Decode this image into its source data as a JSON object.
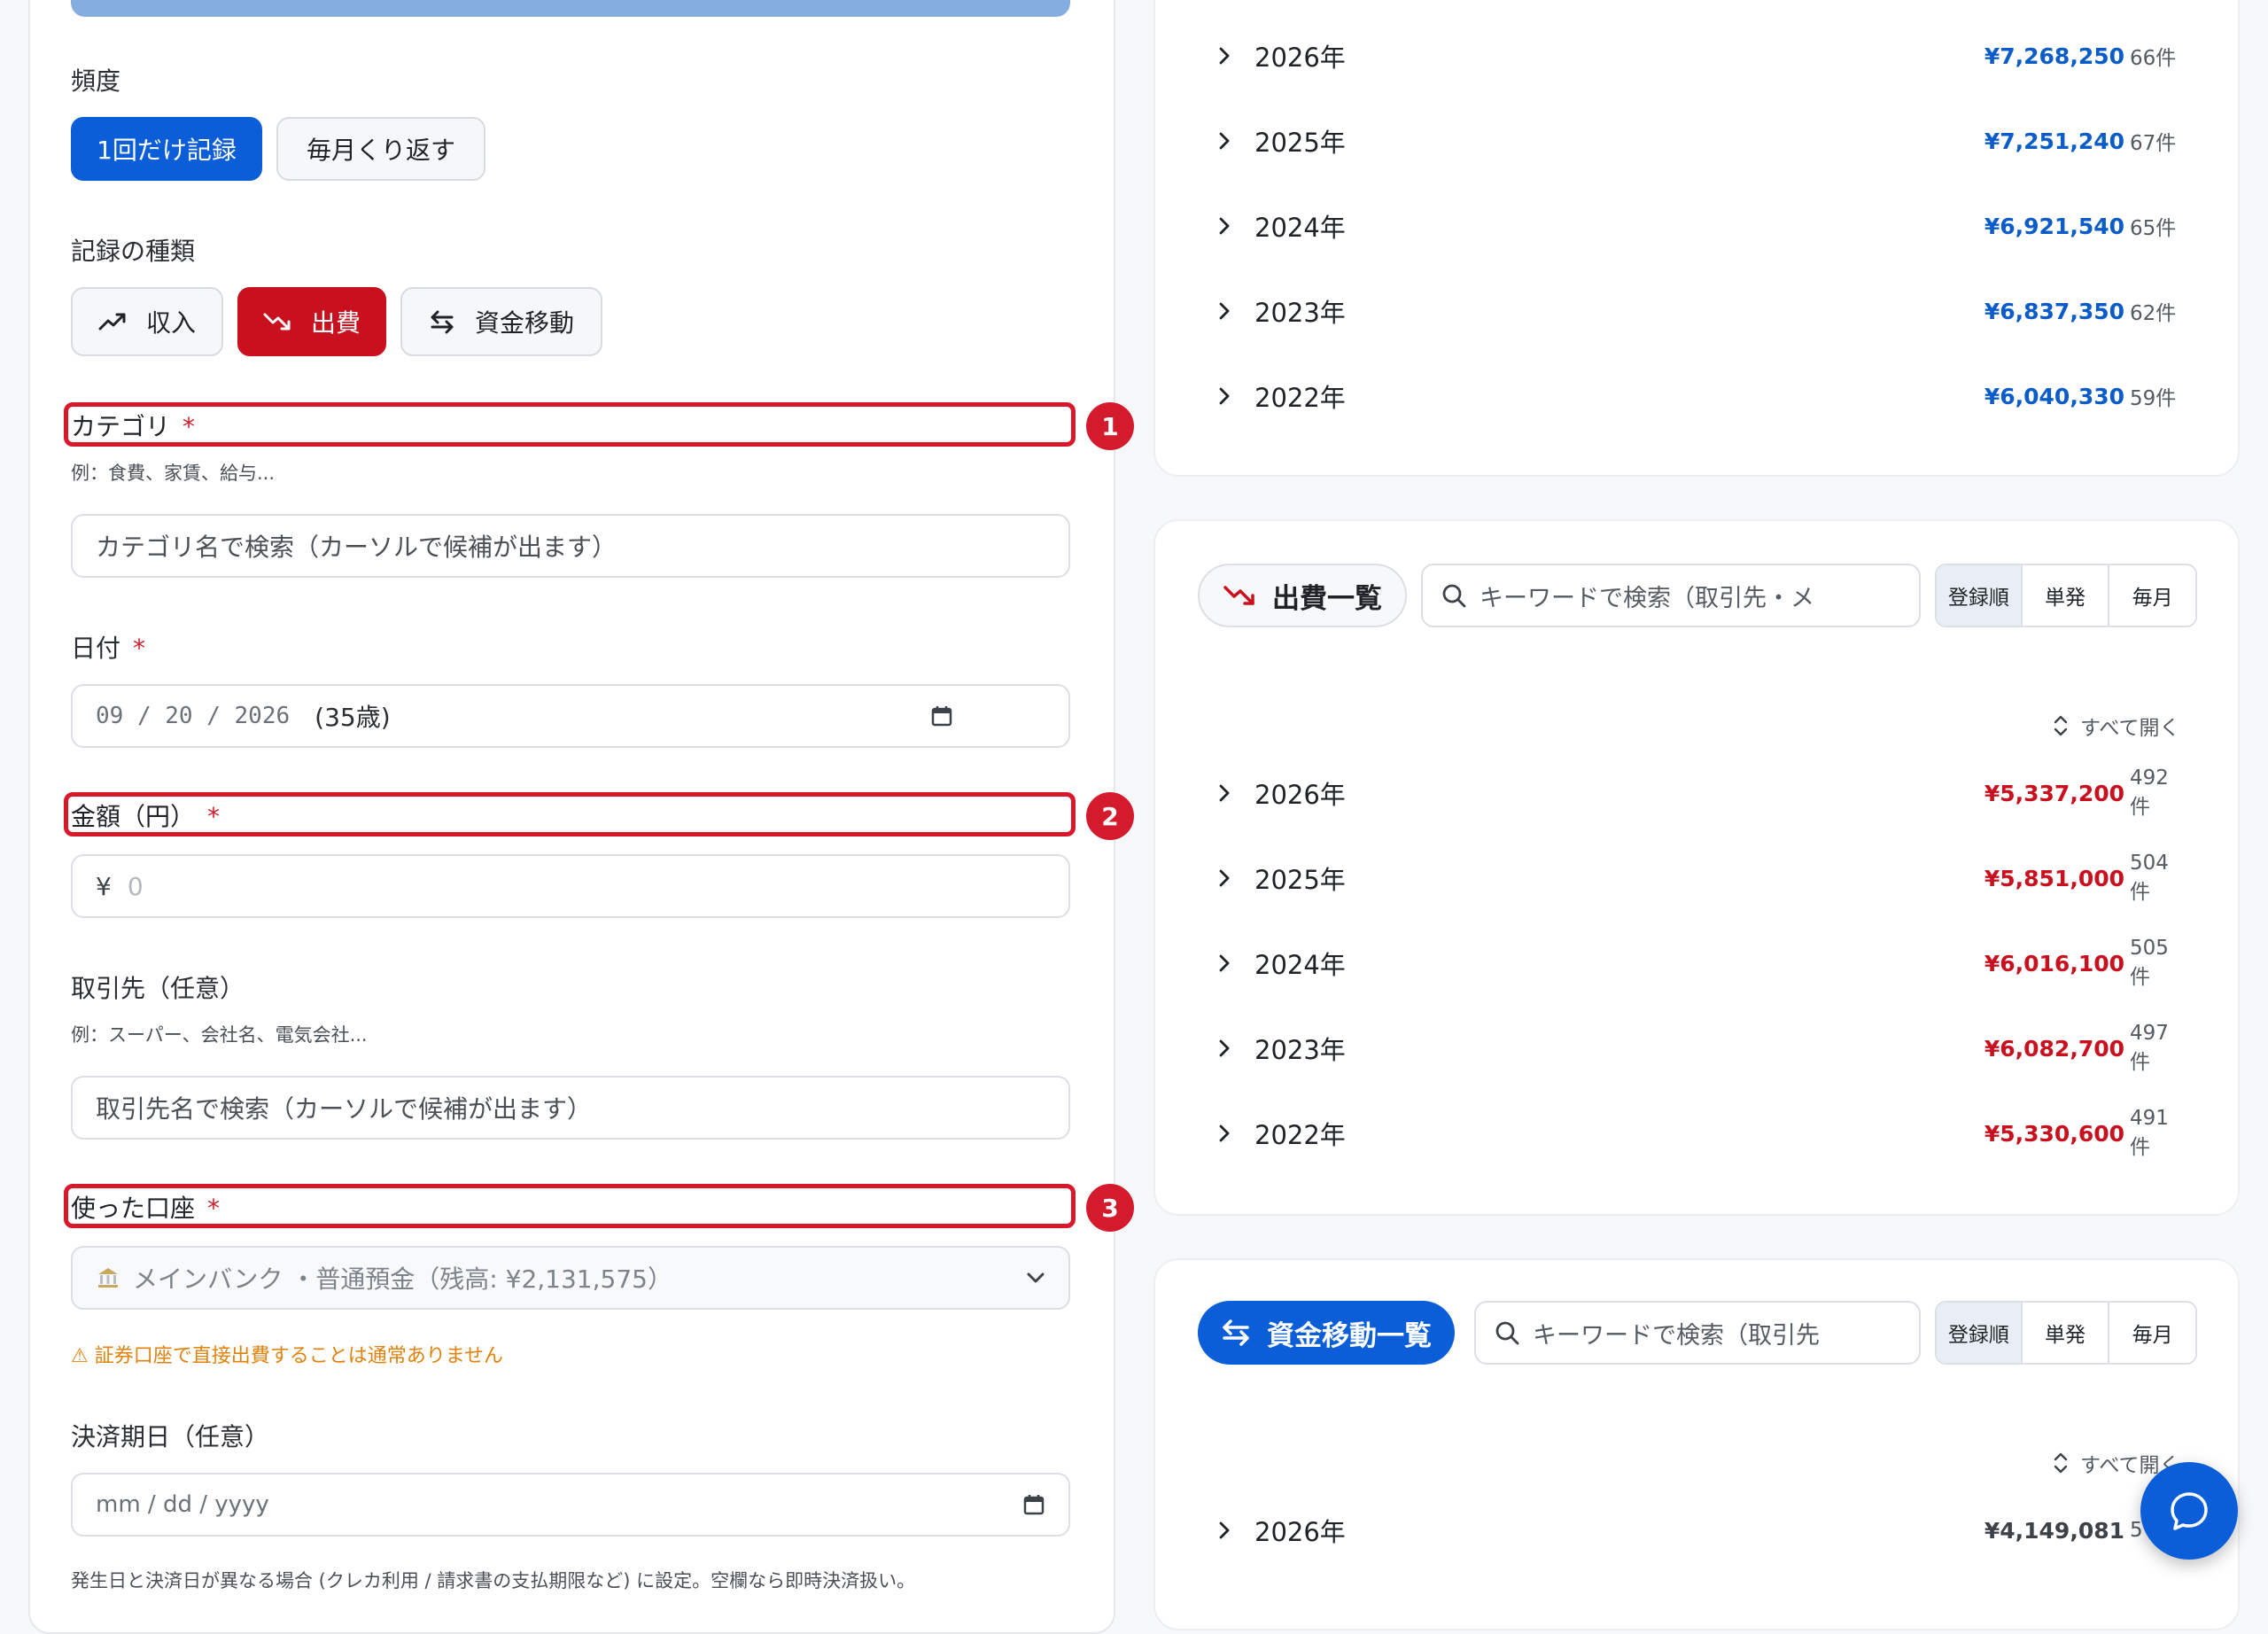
{
  "form": {
    "frequency_label": "頻度",
    "frequency_once": "1回だけ記録",
    "frequency_monthly": "毎月くり返す",
    "type_label": "記録の種類",
    "type_income": "収入",
    "type_expense": "出費",
    "type_transfer": "資金移動",
    "category_label": "カテゴリ",
    "category_hint": "例：食費、家賃、給与...",
    "category_placeholder": "カテゴリ名で検索（カーソルで候補が出ます）",
    "date_label": "日付",
    "date_value": "09 / 20 / 2026",
    "date_age": "(35歳)",
    "amount_label": "金額（円）",
    "amount_currency": "¥",
    "amount_placeholder": "0",
    "payee_label": "取引先（任意）",
    "payee_hint": "例：スーパー、会社名、電気会社...",
    "payee_placeholder": "取引先名で検索（カーソルで候補が出ます）",
    "account_label": "使った口座",
    "account_value": "メインバンク ・普通預金（残高: ¥2,131,575）",
    "account_warning": "⚠ 証券口座で直接出費することは通常ありません",
    "settlement_label": "決済期日（任意）",
    "settlement_placeholder": "mm / dd / yyyy",
    "settlement_note": "発生日と決済日が異なる場合 (クレカ利用 / 請求書の支払期限など) に設定。空欄なら即時決済扱い。",
    "required_mark": "*",
    "badges": [
      "1",
      "2",
      "3"
    ]
  },
  "income_years": [
    {
      "year": "2026年",
      "amount": "¥7,268,250",
      "count": "66件"
    },
    {
      "year": "2025年",
      "amount": "¥7,251,240",
      "count": "67件"
    },
    {
      "year": "2024年",
      "amount": "¥6,921,540",
      "count": "65件"
    },
    {
      "year": "2023年",
      "amount": "¥6,837,350",
      "count": "62件"
    },
    {
      "year": "2022年",
      "amount": "¥6,040,330",
      "count": "59件"
    }
  ],
  "expense_panel": {
    "title": "出費一覧",
    "search_placeholder": "キーワードで検索（取引先・メ",
    "sort_options": [
      "登録順",
      "単発",
      "毎月"
    ],
    "expand_all": "すべて開く",
    "years": [
      {
        "year": "2026年",
        "amount": "¥5,337,200",
        "count": "492件"
      },
      {
        "year": "2025年",
        "amount": "¥5,851,000",
        "count": "504件"
      },
      {
        "year": "2024年",
        "amount": "¥6,016,100",
        "count": "505件"
      },
      {
        "year": "2023年",
        "amount": "¥6,082,700",
        "count": "497件"
      },
      {
        "year": "2022年",
        "amount": "¥5,330,600",
        "count": "491件"
      }
    ]
  },
  "transfer_panel": {
    "title": "資金移動一覧",
    "search_placeholder": "キーワードで検索（取引先",
    "sort_options": [
      "登録順",
      "単発",
      "毎月"
    ],
    "expand_all": "すべて開く",
    "years": [
      {
        "year": "2026年",
        "amount": "¥4,149,081",
        "count": "5"
      }
    ]
  },
  "colors": {
    "accent_blue": "#0b5ed7",
    "expense_red": "#c8101e",
    "highlight_red": "#d7192b",
    "warning_orange": "#e0830e"
  },
  "icons": [
    "trending-up-icon",
    "trending-down-icon",
    "transfer-arrows-icon",
    "calendar-icon",
    "bank-icon",
    "chevron-down-icon",
    "chevron-right-icon",
    "search-icon",
    "expand-icon",
    "chat-icon"
  ]
}
